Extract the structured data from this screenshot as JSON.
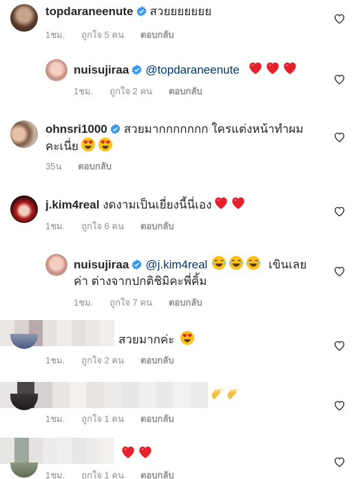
{
  "colors": {
    "mention": "#00376b",
    "meta": "#8e8e8e",
    "heart": "#ed1c24",
    "verified": "#3897f0"
  },
  "comments": [
    {
      "user": "topdaraneenute",
      "verified": true,
      "text": "สวยยยยยยย",
      "time": "1ชม.",
      "likes": "ถูกใจ 5 คน",
      "reply": "ตอบกลับ"
    },
    {
      "user": "nuisujiraa",
      "verified": true,
      "mention": "@topdaraneenute",
      "time": "1ชม.",
      "likes": "ถูกใจ 2 คน",
      "reply": "ตอบกลับ",
      "emoji": [
        "red-heart",
        "red-heart",
        "red-heart"
      ]
    },
    {
      "user": "ohnsri1000",
      "verified": true,
      "text": "สวยมากกกกกกก ใครแต่งหน้าทำผม",
      "text2": "คะเนี่ย",
      "time": "35น",
      "reply": "ตอบกลับ",
      "emoji": [
        "heart-eyes",
        "heart-eyes"
      ]
    },
    {
      "user": "j.kim4real",
      "verified": false,
      "text": "งดงามเป็นเยี่ยงนี้นี่เอง",
      "time": "1ชม.",
      "likes": "ถูกใจ 6 คน",
      "reply": "ตอบกลับ",
      "emoji": [
        "red-heart",
        "red-heart"
      ]
    },
    {
      "user": "nuisujiraa",
      "verified": true,
      "mention": "@j.kim4real",
      "text": "เขินเลย",
      "text2": "ค่า ต่างจากปกติชิมิคะพี่คิ้ม",
      "time": "1ชม.",
      "likes": "ถูกใจ 7 คน",
      "reply": "ตอบกลับ",
      "emoji": [
        "joy",
        "joy",
        "joy"
      ]
    },
    {
      "text": "สวยมากค่ะ",
      "time": "1ชม.",
      "likes": "ถูกใจ 2 คน",
      "reply": "ตอบกลับ",
      "emoji": [
        "heart-eyes"
      ]
    },
    {
      "time": "1ชม.",
      "likes": "ถูกใจ 1 คน",
      "reply": "ตอบกลับ",
      "emoji": [
        "clapping-hands",
        "clapping-hands"
      ]
    },
    {
      "time": "1ชม.",
      "likes": "ถูกใจ 1 คน",
      "reply": "ตอบกลับ",
      "emoji": [
        "red-heart",
        "red-heart"
      ]
    }
  ]
}
